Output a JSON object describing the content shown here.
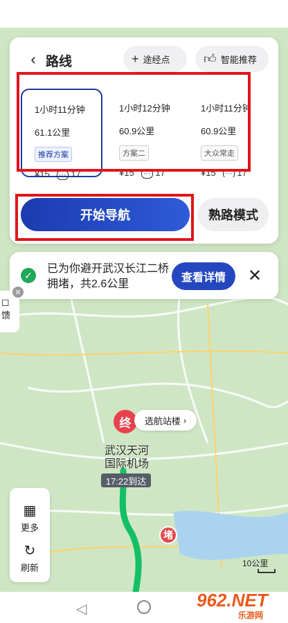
{
  "header": {
    "title": "路线",
    "waypoint_label": "途经点",
    "smart_label": "智能推荐"
  },
  "routes": [
    {
      "time": "1小时11分钟",
      "distance": "61.1公里",
      "tag": "推荐方案",
      "cost": "¥15",
      "lights": "17",
      "selected": true
    },
    {
      "time": "1小时12分钟",
      "distance": "60.9公里",
      "tag": "方案二",
      "cost": "¥15",
      "lights": "17",
      "selected": false
    },
    {
      "time": "1小时11分钟",
      "distance": "60.9公里",
      "tag": "大众常走",
      "cost": "¥15",
      "lights": "17",
      "selected": false
    }
  ],
  "actions": {
    "start_nav": "开始导航",
    "familiar_mode": "熟路模式"
  },
  "notice": {
    "message": "已为你避开武汉长江二桥拥堵，共2.6公里",
    "detail_label": "查看详情"
  },
  "feedback": {
    "label": "馈"
  },
  "map": {
    "destination_marker": "终",
    "destination_select": "选航站楼",
    "airport_name": "武汉天河国际机场",
    "arrival": "17:22到达",
    "jam_marker": "堵",
    "scale": "10公里",
    "route_color": "#13c065"
  },
  "tools": {
    "more": "更多",
    "refresh": "刷新"
  },
  "watermark": {
    "brand": "962.NET",
    "sub": "乐游网"
  },
  "colors": {
    "accent": "#1c3bb0",
    "highlight": "#e0151b"
  }
}
